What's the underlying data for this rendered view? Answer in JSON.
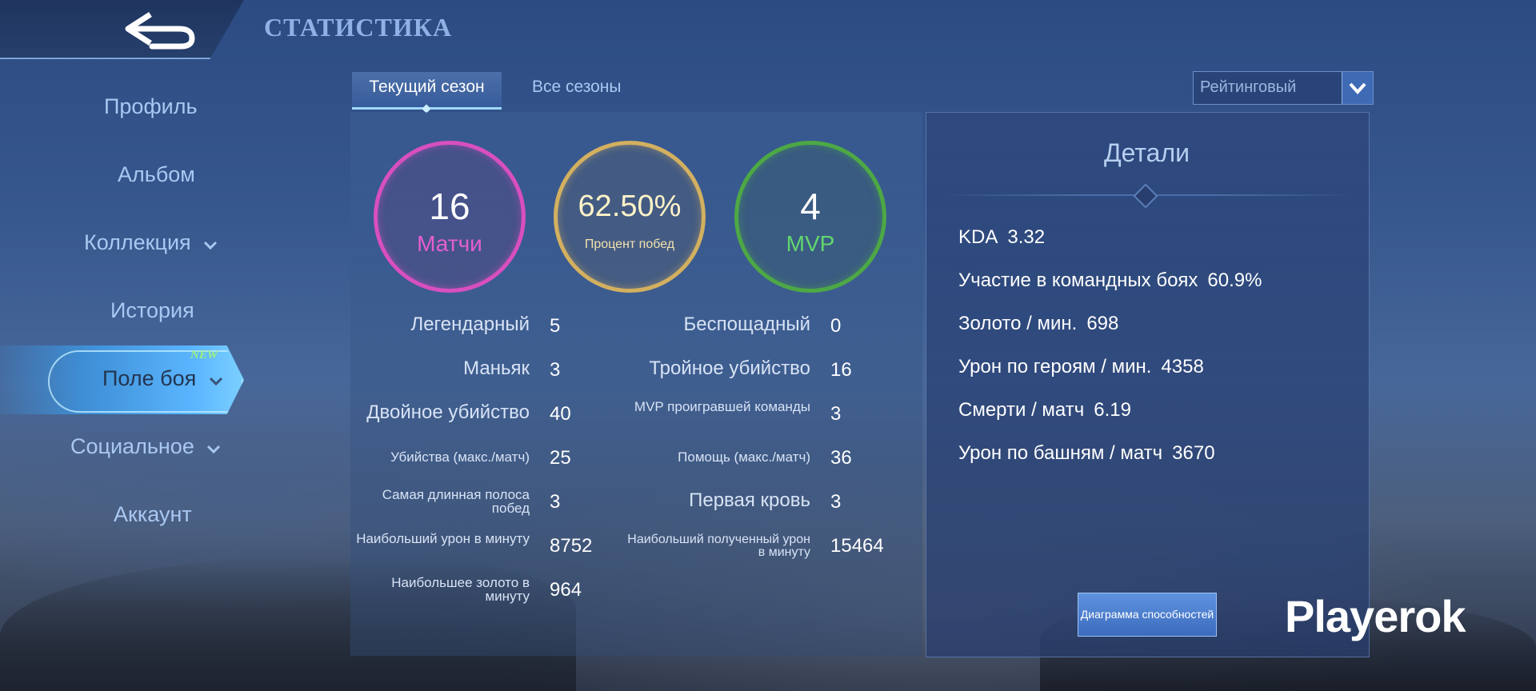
{
  "header": {
    "title": "СТАТИСТИКА"
  },
  "menu": [
    {
      "label": "Профиль"
    },
    {
      "label": "Альбом"
    },
    {
      "label": "Коллекция"
    },
    {
      "label": "История"
    },
    {
      "label": "Поле боя",
      "badge": "NEW"
    },
    {
      "label": "Социальное"
    },
    {
      "label": "Аккаунт"
    }
  ],
  "tabs": {
    "current": "Текущий сезон",
    "all": "Все сезоны"
  },
  "mode_select": {
    "value": "Рейтинговый"
  },
  "summary": {
    "matches": {
      "value": "16",
      "label": "Матчи"
    },
    "winrate": {
      "value": "62.50%",
      "label": "Процент побед"
    },
    "mvp": {
      "value": "4",
      "label": "MVP"
    }
  },
  "stats_left": [
    {
      "label": "Легендарный",
      "value": "5"
    },
    {
      "label": "Маньяк",
      "value": "3"
    },
    {
      "label": "Двойное убийство",
      "value": "40"
    },
    {
      "label": "Убийства (макс./матч)",
      "value": "25"
    },
    {
      "label": "Самая длинная полоса побед",
      "value": "3"
    },
    {
      "label": "Наибольший урон в минуту",
      "value": "8752"
    },
    {
      "label": "Наибольшее золото в минуту",
      "value": "964"
    }
  ],
  "stats_right": [
    {
      "label": "Беспощадный",
      "value": "0"
    },
    {
      "label": "Тройное убийство",
      "value": "16"
    },
    {
      "label": "MVP проигравшей команды",
      "value": "3"
    },
    {
      "label": "Помощь (макс./матч)",
      "value": "36"
    },
    {
      "label": "Первая кровь",
      "value": "3"
    },
    {
      "label": "Наибольший полученный урон в минуту",
      "value": "15464"
    }
  ],
  "details": {
    "title": "Детали",
    "rows": [
      {
        "label": "KDA",
        "value": "3.32"
      },
      {
        "label": "Участие в командных боях",
        "value": "60.9%"
      },
      {
        "label": "Золото / мин.",
        "value": "698"
      },
      {
        "label": "Урон по героям / мин.",
        "value": "4358"
      },
      {
        "label": "Смерти / матч",
        "value": "6.19"
      },
      {
        "label": "Урон по башням / матч",
        "value": "3670"
      }
    ],
    "ability_button": "Диаграмма способностей"
  },
  "watermark": "Playerok",
  "colors": {
    "matches_ring": "#d84fbf",
    "winrate_ring": "#d3b060",
    "mvp_ring": "#4da845",
    "accent": "#5bb6ff"
  }
}
